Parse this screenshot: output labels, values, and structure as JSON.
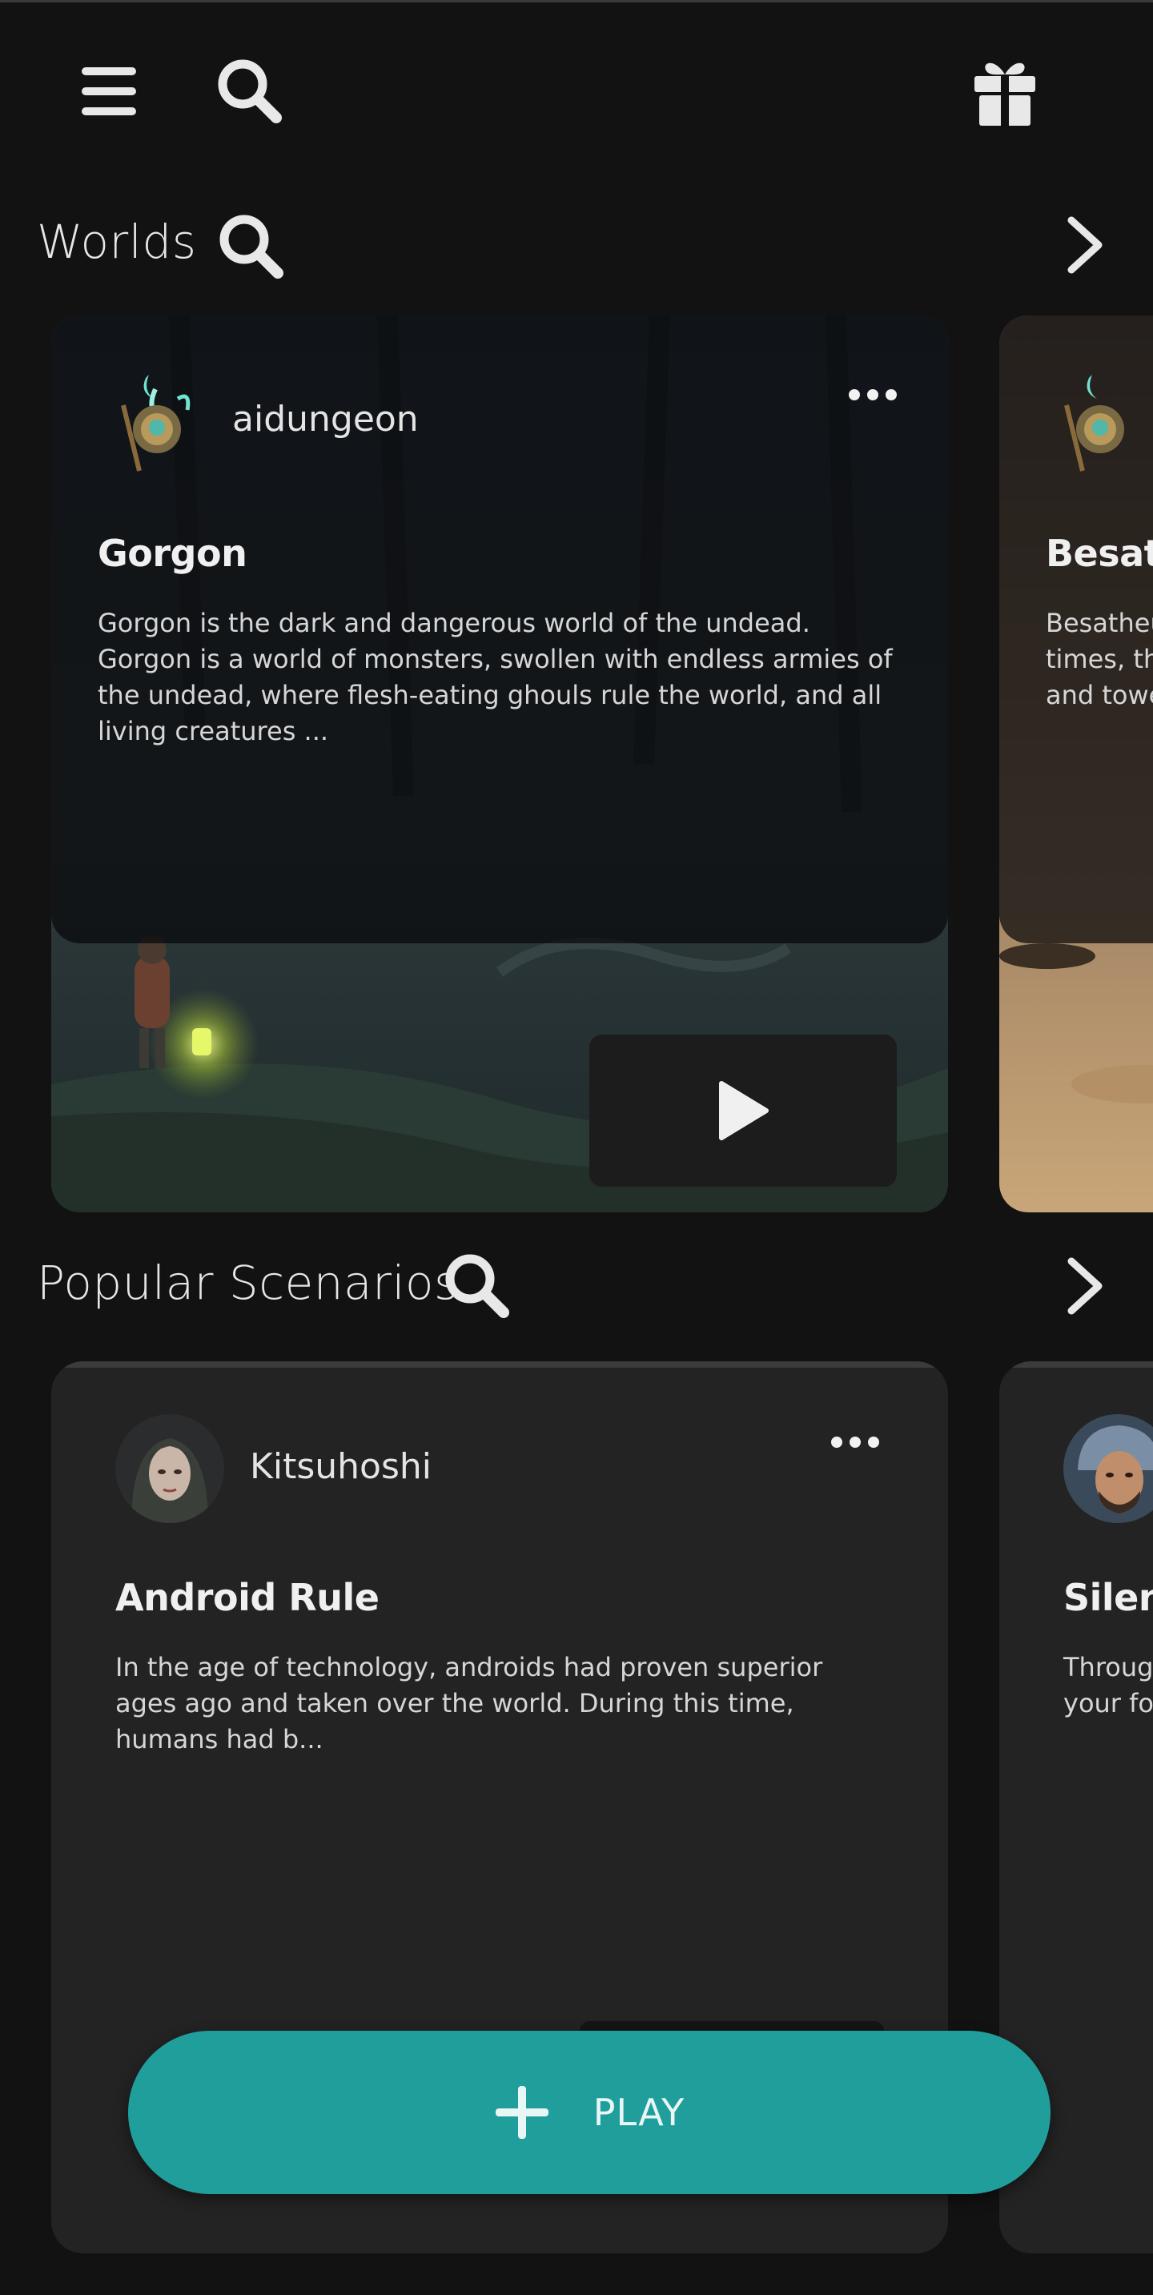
{
  "header": {
    "menu_icon": "hamburger-menu-icon",
    "search_icon": "search-icon",
    "gift_icon": "gift-icon"
  },
  "worlds": {
    "title": "Worlds",
    "cards": [
      {
        "author": "aidungeon",
        "title": "Gorgon",
        "description": "Gorgon is the dark and dangerous world of the undead. Gorgon is a world of monsters, swollen with endless armies of the undead, where flesh-eating ghouls rule the world, and all living creatures ..."
      },
      {
        "title": "Besath",
        "description_lines": [
          "Besatheu",
          "times, the",
          "and towe"
        ]
      }
    ]
  },
  "scenarios": {
    "title": "Popular Scenarios",
    "cards": [
      {
        "author": "Kitsuhoshi",
        "title": "Android Rule",
        "description": "In the age of technology, androids had proven superior ages ago and taken over the world. During this time, humans had b..."
      },
      {
        "title": "Silent",
        "description_lines": [
          "Through",
          "your for"
        ]
      }
    ]
  },
  "play_button": {
    "label": "PLAY"
  },
  "colors": {
    "background": "#121212",
    "accent": "#209e9c",
    "card": "#232323"
  }
}
